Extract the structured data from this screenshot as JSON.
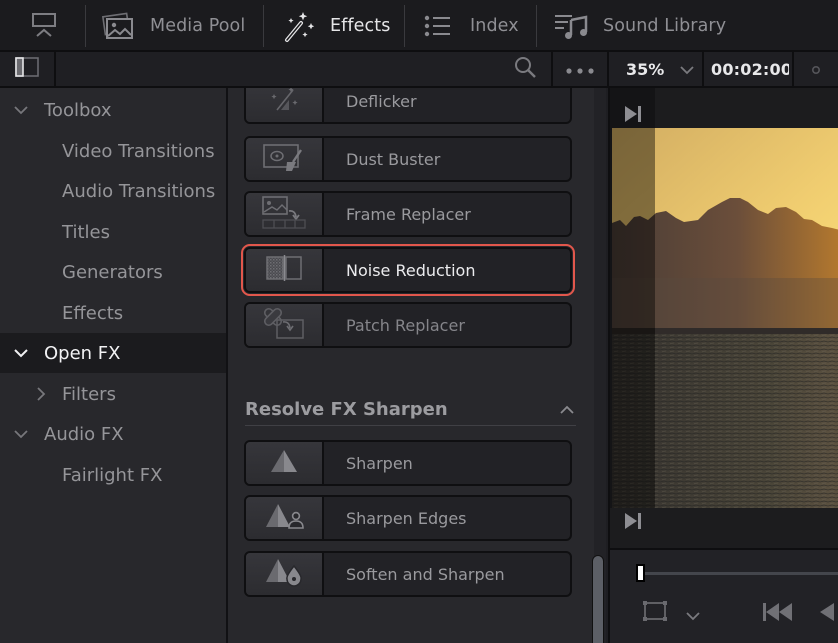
{
  "topnav": {
    "items": [
      {
        "id": "workspace",
        "label": "",
        "icon": "workspace-monitor-icon"
      },
      {
        "id": "media-pool",
        "label": "Media Pool",
        "icon": "media-pool-icon",
        "active": false
      },
      {
        "id": "effects",
        "label": "Effects",
        "icon": "magic-wand-icon",
        "active": true
      },
      {
        "id": "index",
        "label": "Index",
        "icon": "list-icon",
        "active": false
      },
      {
        "id": "sound-library",
        "label": "Sound Library",
        "icon": "music-library-icon",
        "active": false
      }
    ]
  },
  "toolbar": {
    "panel_toggle_icon": "panel-toggle-icon",
    "search_icon": "search-icon",
    "more_icon": "more-dots-icon",
    "zoom_level": "35%",
    "timecode": "00:02:00",
    "dot_icon": "record-dot-icon"
  },
  "sidebar": {
    "items": [
      {
        "label": "Toolbox",
        "level": 0,
        "expanded": true,
        "selected": false
      },
      {
        "label": "Video Transitions",
        "level": 1,
        "selected": false
      },
      {
        "label": "Audio Transitions",
        "level": 1,
        "selected": false
      },
      {
        "label": "Titles",
        "level": 1,
        "selected": false
      },
      {
        "label": "Generators",
        "level": 1,
        "selected": false
      },
      {
        "label": "Effects",
        "level": 1,
        "selected": false
      },
      {
        "label": "Open FX",
        "level": 0,
        "expanded": true,
        "selected": true
      },
      {
        "label": "Filters",
        "level": 1,
        "expanded": false,
        "selected": false
      },
      {
        "label": "Audio FX",
        "level": 0,
        "expanded": true,
        "selected": false
      },
      {
        "label": "Fairlight FX",
        "level": 1,
        "selected": false
      }
    ]
  },
  "effects_list": {
    "items": [
      {
        "name": "Deflicker",
        "icon": "deflicker-icon"
      },
      {
        "name": "Dust Buster",
        "icon": "dust-buster-icon"
      },
      {
        "name": "Frame Replacer",
        "icon": "frame-replacer-icon"
      },
      {
        "name": "Noise Reduction",
        "icon": "noise-reduction-icon",
        "highlighted": true
      },
      {
        "name": "Patch Replacer",
        "icon": "patch-replacer-icon"
      }
    ],
    "section": {
      "title": "Resolve FX Sharpen",
      "collapse_icon": "chevron-up-icon",
      "items": [
        {
          "name": "Sharpen",
          "icon": "sharpen-icon"
        },
        {
          "name": "Sharpen Edges",
          "icon": "sharpen-edges-icon"
        },
        {
          "name": "Soften and Sharpen",
          "icon": "soften-sharpen-icon"
        }
      ]
    },
    "highlight_color": "#e2574c"
  },
  "viewer": {
    "top_icon": "go-to-end-icon",
    "bottom_icon": "go-to-end-icon",
    "playhead_position": 0,
    "transport": {
      "transform_icon": "transform-box-icon",
      "dropdown_icon": "chevron-down-icon",
      "prev_icon": "skip-back-icon",
      "rev_icon": "play-reverse-icon"
    }
  }
}
